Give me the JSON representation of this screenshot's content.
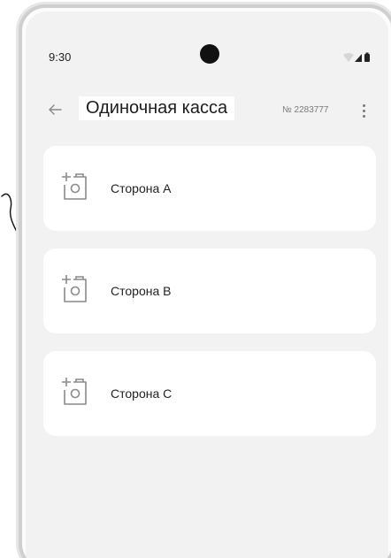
{
  "status_bar": {
    "time": "9:30",
    "icons": [
      "wifi-icon",
      "cell-signal-icon",
      "battery-icon"
    ]
  },
  "header": {
    "back_icon": "arrow-left-icon",
    "title": "Одиночная касса",
    "number": "№ 2283777",
    "menu_icon": "more-vertical-icon"
  },
  "cards": [
    {
      "label": "Сторона А",
      "icon": "add-photo-icon"
    },
    {
      "label": "Сторона В",
      "icon": "add-photo-icon"
    },
    {
      "label": "Сторона С",
      "icon": "add-photo-icon"
    }
  ],
  "colors": {
    "background": "#f2f2f2",
    "card": "#ffffff",
    "text": "#222222",
    "icon": "#8a8a8a"
  }
}
